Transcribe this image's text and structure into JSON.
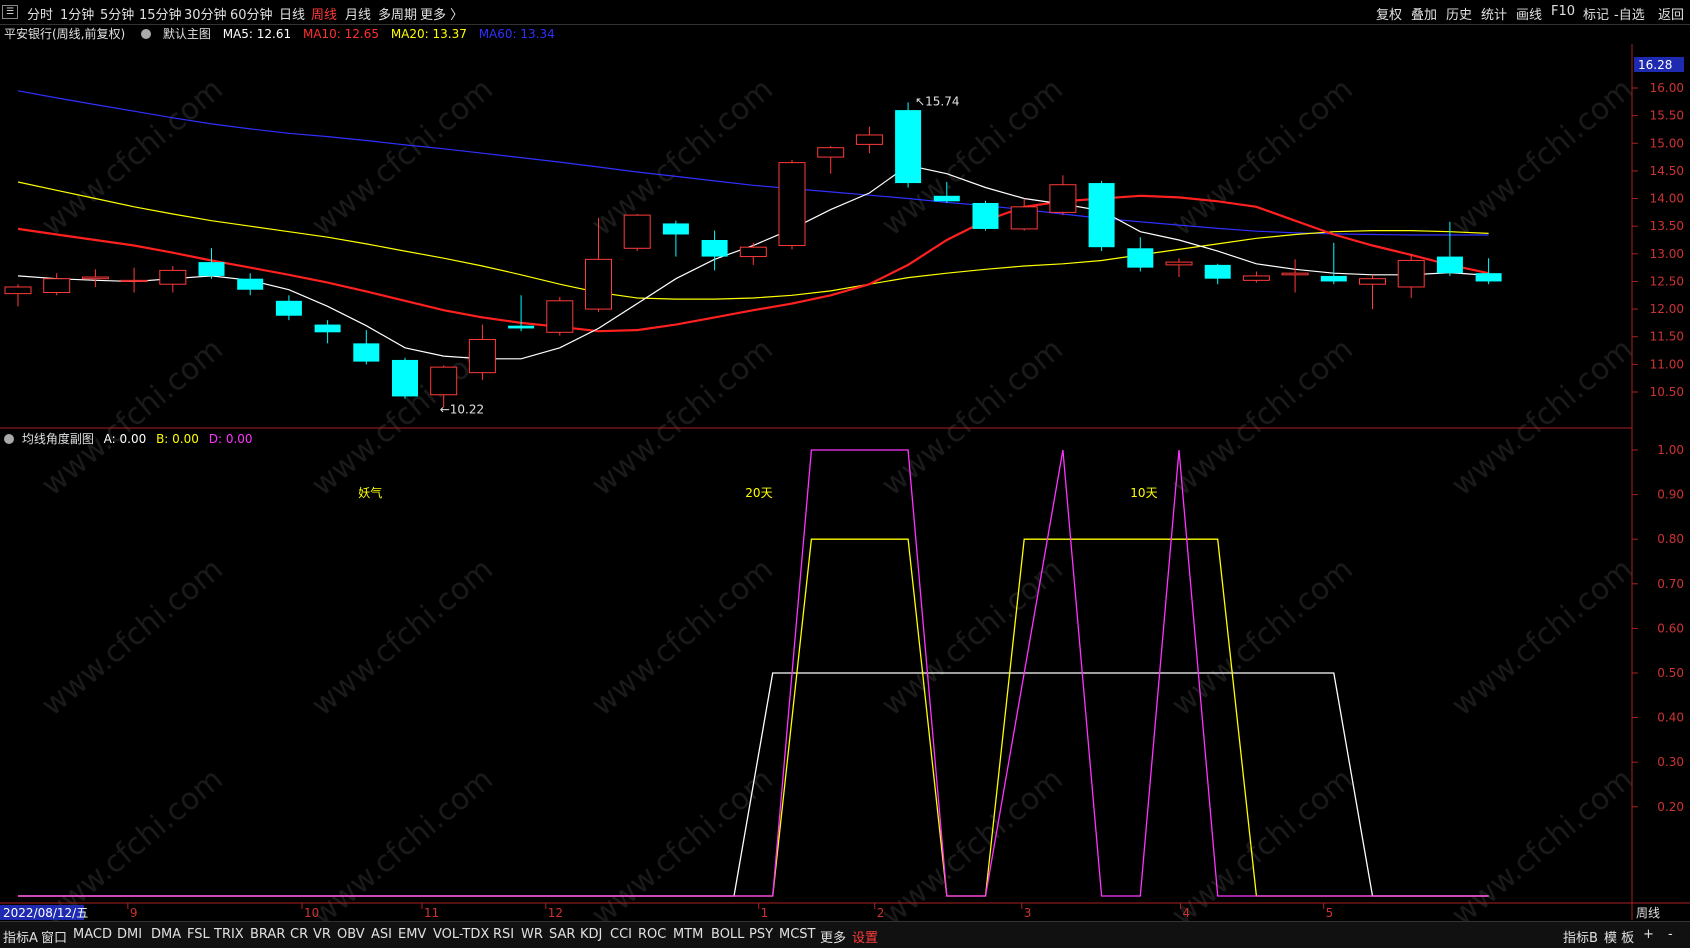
{
  "topbar": {
    "periods": [
      "分时",
      "1分钟",
      "5分钟",
      "15分钟",
      "30分钟",
      "60分钟",
      "日线",
      "周线",
      "月线",
      "多周期",
      "更多 〉"
    ],
    "active_period": "周线",
    "right_items": [
      "复权",
      "叠加",
      "历史",
      "统计",
      "画线",
      "F10",
      "标记",
      "-自选",
      "返回"
    ]
  },
  "main_chart": {
    "stock_label": "平安银行(周线,前复权)",
    "indicator_name": "默认主图",
    "ma5": "MA5: 12.61",
    "ma10": "MA10: 12.65",
    "ma20": "MA20: 13.37",
    "ma60": "MA60: 13.34",
    "price_label_current": "16.28",
    "price_axis": [
      "16.00",
      "15.50",
      "15.00",
      "14.50",
      "14.00",
      "13.50",
      "13.00",
      "12.50",
      "12.00",
      "11.50",
      "11.00",
      "10.50"
    ],
    "high_marker": "15.74",
    "low_marker": "10.22",
    "colors": {
      "up": "#ff3a3a",
      "down": "#00ffff",
      "ma5": "#ffffff",
      "ma10": "#ff2020",
      "ma20": "#ffff00",
      "ma60": "#3030ff"
    }
  },
  "sub_chart": {
    "title": "均线角度副图",
    "a_label": "A: 0.00",
    "b_label": "B: 0.00",
    "d_label": "D: 0.00",
    "annotations": [
      "妖气",
      "20天",
      "10天"
    ],
    "axis": [
      "1.00",
      "0.90",
      "0.80",
      "0.70",
      "0.60",
      "0.50",
      "0.40",
      "0.30",
      "0.20"
    ]
  },
  "x_axis": {
    "date_label": "2022/08/12/五",
    "months": [
      "9",
      "10",
      "11",
      "12",
      "1",
      "2",
      "3",
      "4",
      "5"
    ],
    "period_label": "周线"
  },
  "bottombar": {
    "items": [
      "指标A",
      "窗口",
      "MACD",
      "DMI",
      "DMA",
      "FSL",
      "TRIX",
      "BRAR",
      "CR",
      "VR",
      "OBV",
      "ASI",
      "EMV",
      "VOL-TDX",
      "RSI",
      "WR",
      "SAR",
      "KDJ",
      "CCI",
      "ROC",
      "MTM",
      "BOLL",
      "PSY",
      "MCST",
      "更多",
      "设置"
    ],
    "right_items": [
      "指标B",
      "模 板",
      "+",
      "-"
    ]
  },
  "watermark": "www.cfchi.com",
  "chart_data": [
    {
      "type": "candlestick",
      "title": "平安银行(周线,前复权)",
      "candles": [
        {
          "o": 12.28,
          "c": 12.4,
          "h": 12.45,
          "l": 12.05
        },
        {
          "o": 12.3,
          "c": 12.55,
          "h": 12.65,
          "l": 12.25
        },
        {
          "o": 12.55,
          "c": 12.58,
          "h": 12.72,
          "l": 12.4
        },
        {
          "o": 12.5,
          "c": 12.52,
          "h": 12.75,
          "l": 12.3
        },
        {
          "o": 12.45,
          "c": 12.7,
          "h": 12.78,
          "l": 12.3
        },
        {
          "o": 12.85,
          "c": 12.6,
          "h": 13.1,
          "l": 12.55
        },
        {
          "o": 12.55,
          "c": 12.35,
          "h": 12.65,
          "l": 12.25
        },
        {
          "o": 12.15,
          "c": 11.88,
          "h": 12.25,
          "l": 11.8
        },
        {
          "o": 11.72,
          "c": 11.58,
          "h": 11.8,
          "l": 11.38
        },
        {
          "o": 11.38,
          "c": 11.05,
          "h": 11.62,
          "l": 11.0
        },
        {
          "o": 11.08,
          "c": 10.42,
          "h": 11.12,
          "l": 10.38
        },
        {
          "o": 10.45,
          "c": 10.95,
          "h": 10.98,
          "l": 10.22
        },
        {
          "o": 10.85,
          "c": 11.45,
          "h": 11.72,
          "l": 10.72
        },
        {
          "o": 11.7,
          "c": 11.65,
          "h": 12.25,
          "l": 11.6
        },
        {
          "o": 11.58,
          "c": 12.15,
          "h": 12.22,
          "l": 11.52
        },
        {
          "o": 12.0,
          "c": 12.9,
          "h": 13.65,
          "l": 11.95
        },
        {
          "o": 13.1,
          "c": 13.7,
          "h": 13.72,
          "l": 13.05
        },
        {
          "o": 13.55,
          "c": 13.35,
          "h": 13.6,
          "l": 12.95
        },
        {
          "o": 13.25,
          "c": 12.95,
          "h": 13.42,
          "l": 12.7
        },
        {
          "o": 12.95,
          "c": 13.12,
          "h": 13.2,
          "l": 12.8
        },
        {
          "o": 13.15,
          "c": 14.65,
          "h": 14.7,
          "l": 13.08
        },
        {
          "o": 14.75,
          "c": 14.92,
          "h": 14.95,
          "l": 14.45
        },
        {
          "o": 14.98,
          "c": 15.15,
          "h": 15.3,
          "l": 14.82
        },
        {
          "o": 15.6,
          "c": 14.28,
          "h": 15.74,
          "l": 14.2
        },
        {
          "o": 14.05,
          "c": 13.95,
          "h": 14.3,
          "l": 13.92
        },
        {
          "o": 13.92,
          "c": 13.45,
          "h": 13.96,
          "l": 13.42
        },
        {
          "o": 13.45,
          "c": 13.85,
          "h": 14.0,
          "l": 13.42
        },
        {
          "o": 13.75,
          "c": 14.25,
          "h": 14.42,
          "l": 13.7
        },
        {
          "o": 14.28,
          "c": 13.12,
          "h": 14.32,
          "l": 13.05
        },
        {
          "o": 13.1,
          "c": 12.75,
          "h": 13.3,
          "l": 12.68
        },
        {
          "o": 12.8,
          "c": 12.85,
          "h": 12.92,
          "l": 12.58
        },
        {
          "o": 12.8,
          "c": 12.55,
          "h": 12.82,
          "l": 12.45
        },
        {
          "o": 12.52,
          "c": 12.6,
          "h": 12.68,
          "l": 12.48
        },
        {
          "o": 12.62,
          "c": 12.65,
          "h": 12.9,
          "l": 12.3
        },
        {
          "o": 12.6,
          "c": 12.5,
          "h": 13.2,
          "l": 12.45
        },
        {
          "o": 12.45,
          "c": 12.55,
          "h": 12.62,
          "l": 12.0
        },
        {
          "o": 12.4,
          "c": 12.88,
          "h": 13.0,
          "l": 12.2
        },
        {
          "o": 12.95,
          "c": 12.65,
          "h": 13.58,
          "l": 12.6
        },
        {
          "o": 12.65,
          "c": 12.5,
          "h": 12.92,
          "l": 12.45
        }
      ],
      "ma5": [
        12.6,
        12.55,
        12.52,
        12.5,
        12.55,
        12.6,
        12.52,
        12.35,
        12.05,
        11.7,
        11.3,
        11.15,
        11.1,
        11.1,
        11.3,
        11.65,
        12.1,
        12.55,
        12.9,
        13.15,
        13.45,
        13.8,
        14.1,
        14.6,
        14.45,
        14.2,
        14.0,
        13.9,
        13.78,
        13.4,
        13.25,
        13.05,
        12.82,
        12.72,
        12.65,
        12.62,
        12.62,
        12.66,
        12.61
      ],
      "ma10": [
        13.45,
        13.35,
        13.25,
        13.15,
        13.02,
        12.88,
        12.75,
        12.62,
        12.48,
        12.32,
        12.15,
        11.98,
        11.85,
        11.75,
        11.68,
        11.6,
        11.62,
        11.72,
        11.85,
        11.98,
        12.1,
        12.25,
        12.45,
        12.8,
        13.25,
        13.6,
        13.85,
        13.95,
        14.0,
        14.05,
        14.02,
        13.95,
        13.85,
        13.6,
        13.35,
        13.15,
        12.98,
        12.8,
        12.65
      ],
      "ma20": [
        14.3,
        14.15,
        14.0,
        13.85,
        13.72,
        13.6,
        13.5,
        13.4,
        13.3,
        13.18,
        13.05,
        12.92,
        12.78,
        12.62,
        12.45,
        12.3,
        12.2,
        12.18,
        12.18,
        12.2,
        12.25,
        12.33,
        12.45,
        12.57,
        12.65,
        12.72,
        12.78,
        12.82,
        12.88,
        12.98,
        13.08,
        13.18,
        13.28,
        13.35,
        13.4,
        13.42,
        13.42,
        13.4,
        13.37
      ],
      "ma60": [
        15.95,
        15.82,
        15.7,
        15.58,
        15.46,
        15.35,
        15.26,
        15.18,
        15.12,
        15.05,
        14.97,
        14.9,
        14.82,
        14.74,
        14.66,
        14.57,
        14.48,
        14.4,
        14.32,
        14.24,
        14.18,
        14.12,
        14.06,
        14.0,
        13.93,
        13.87,
        13.8,
        13.72,
        13.64,
        13.58,
        13.52,
        13.46,
        13.41,
        13.38,
        13.36,
        13.35,
        13.34,
        13.34,
        13.34
      ]
    },
    {
      "type": "line",
      "title": "均线角度副图",
      "series": [
        {
          "name": "A",
          "color": "#ffffff",
          "points": [
            [
              0,
              0
            ],
            [
              18.5,
              0
            ],
            [
              19.5,
              0.5
            ],
            [
              34,
              0.5
            ],
            [
              35,
              0
            ],
            [
              38,
              0
            ]
          ]
        },
        {
          "name": "B",
          "color": "#ffff00",
          "points": [
            [
              0,
              0
            ],
            [
              19.5,
              0
            ],
            [
              20.5,
              0.8
            ],
            [
              23,
              0.8
            ],
            [
              24,
              0
            ],
            [
              25,
              0
            ],
            [
              26,
              0.8
            ],
            [
              31,
              0.8
            ],
            [
              32,
              0
            ],
            [
              38,
              0
            ]
          ]
        },
        {
          "name": "D",
          "color": "#ff33ff",
          "points": [
            [
              0,
              0
            ],
            [
              19.5,
              0
            ],
            [
              20.5,
              1.0
            ],
            [
              23,
              1.0
            ],
            [
              24,
              0
            ],
            [
              25,
              0
            ],
            [
              27,
              1.0
            ],
            [
              28,
              0
            ],
            [
              29,
              0
            ],
            [
              30,
              1.0
            ],
            [
              31,
              0
            ],
            [
              38,
              0
            ]
          ]
        }
      ]
    }
  ]
}
